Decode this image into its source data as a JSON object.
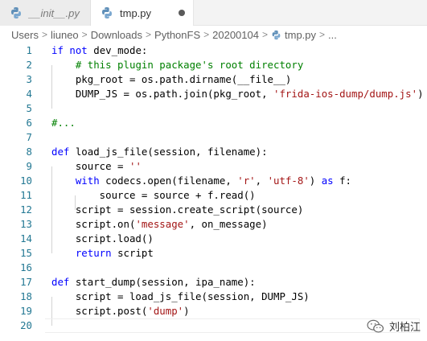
{
  "tabs": [
    {
      "label": "__init__.py",
      "active": false,
      "icon": "python-file-icon"
    },
    {
      "label": "tmp.py",
      "active": true,
      "dirty": true,
      "icon": "python-file-icon"
    }
  ],
  "breadcrumb": [
    "Users",
    "liuneo",
    "Downloads",
    "PythonFS",
    "20200104",
    "tmp.py",
    "..."
  ],
  "lines": [
    {
      "num": "1",
      "tokens": [
        [
          "kw",
          "if"
        ],
        [
          "",
          " "
        ],
        [
          "kw",
          "not"
        ],
        [
          "",
          " dev_mode:"
        ]
      ]
    },
    {
      "num": "2",
      "tokens": [
        [
          "",
          "    "
        ],
        [
          "cm",
          "# this plugin package's root directory"
        ]
      ]
    },
    {
      "num": "3",
      "tokens": [
        [
          "",
          "    pkg_root = os.path.dirname(__file__)"
        ]
      ]
    },
    {
      "num": "4",
      "tokens": [
        [
          "",
          "    DUMP_JS = os.path.join(pkg_root, "
        ],
        [
          "str",
          "'frida-ios-dump/dump.js'"
        ],
        [
          "",
          ")"
        ]
      ]
    },
    {
      "num": "5",
      "tokens": []
    },
    {
      "num": "6",
      "tokens": [
        [
          "cm",
          "#..."
        ]
      ]
    },
    {
      "num": "7",
      "tokens": []
    },
    {
      "num": "8",
      "tokens": [
        [
          "kw",
          "def"
        ],
        [
          "",
          " load_js_file(session, filename):"
        ]
      ]
    },
    {
      "num": "9",
      "tokens": [
        [
          "",
          "    source = "
        ],
        [
          "str",
          "''"
        ]
      ]
    },
    {
      "num": "10",
      "tokens": [
        [
          "",
          "    "
        ],
        [
          "kw",
          "with"
        ],
        [
          "",
          " codecs.open(filename, "
        ],
        [
          "str",
          "'r'"
        ],
        [
          "",
          ", "
        ],
        [
          "str",
          "'utf-8'"
        ],
        [
          "",
          ") "
        ],
        [
          "kw",
          "as"
        ],
        [
          "",
          " f:"
        ]
      ]
    },
    {
      "num": "11",
      "tokens": [
        [
          "",
          "        source = source + f.read()"
        ]
      ]
    },
    {
      "num": "12",
      "tokens": [
        [
          "",
          "    script = session.create_script(source)"
        ]
      ]
    },
    {
      "num": "13",
      "tokens": [
        [
          "",
          "    script.on("
        ],
        [
          "str",
          "'message'"
        ],
        [
          "",
          ", on_message)"
        ]
      ]
    },
    {
      "num": "14",
      "tokens": [
        [
          "",
          "    script.load()"
        ]
      ]
    },
    {
      "num": "15",
      "tokens": [
        [
          "",
          "    "
        ],
        [
          "kw",
          "return"
        ],
        [
          "",
          " script"
        ]
      ]
    },
    {
      "num": "16",
      "tokens": []
    },
    {
      "num": "17",
      "tokens": [
        [
          "kw",
          "def"
        ],
        [
          "",
          " start_dump(session, ipa_name):"
        ]
      ]
    },
    {
      "num": "18",
      "tokens": [
        [
          "",
          "    script = load_js_file(session, DUMP_JS)"
        ]
      ]
    },
    {
      "num": "19",
      "tokens": [
        [
          "",
          "    script.post("
        ],
        [
          "str",
          "'dump'"
        ],
        [
          "",
          ")"
        ]
      ]
    },
    {
      "num": "20",
      "tokens": [],
      "current": true
    }
  ],
  "watermark": {
    "text": "刘柏江",
    "icon": "wechat-icon"
  },
  "colors": {
    "keyword": "#0000ff",
    "comment": "#008000",
    "string": "#a31515",
    "line_number": "#237893"
  }
}
